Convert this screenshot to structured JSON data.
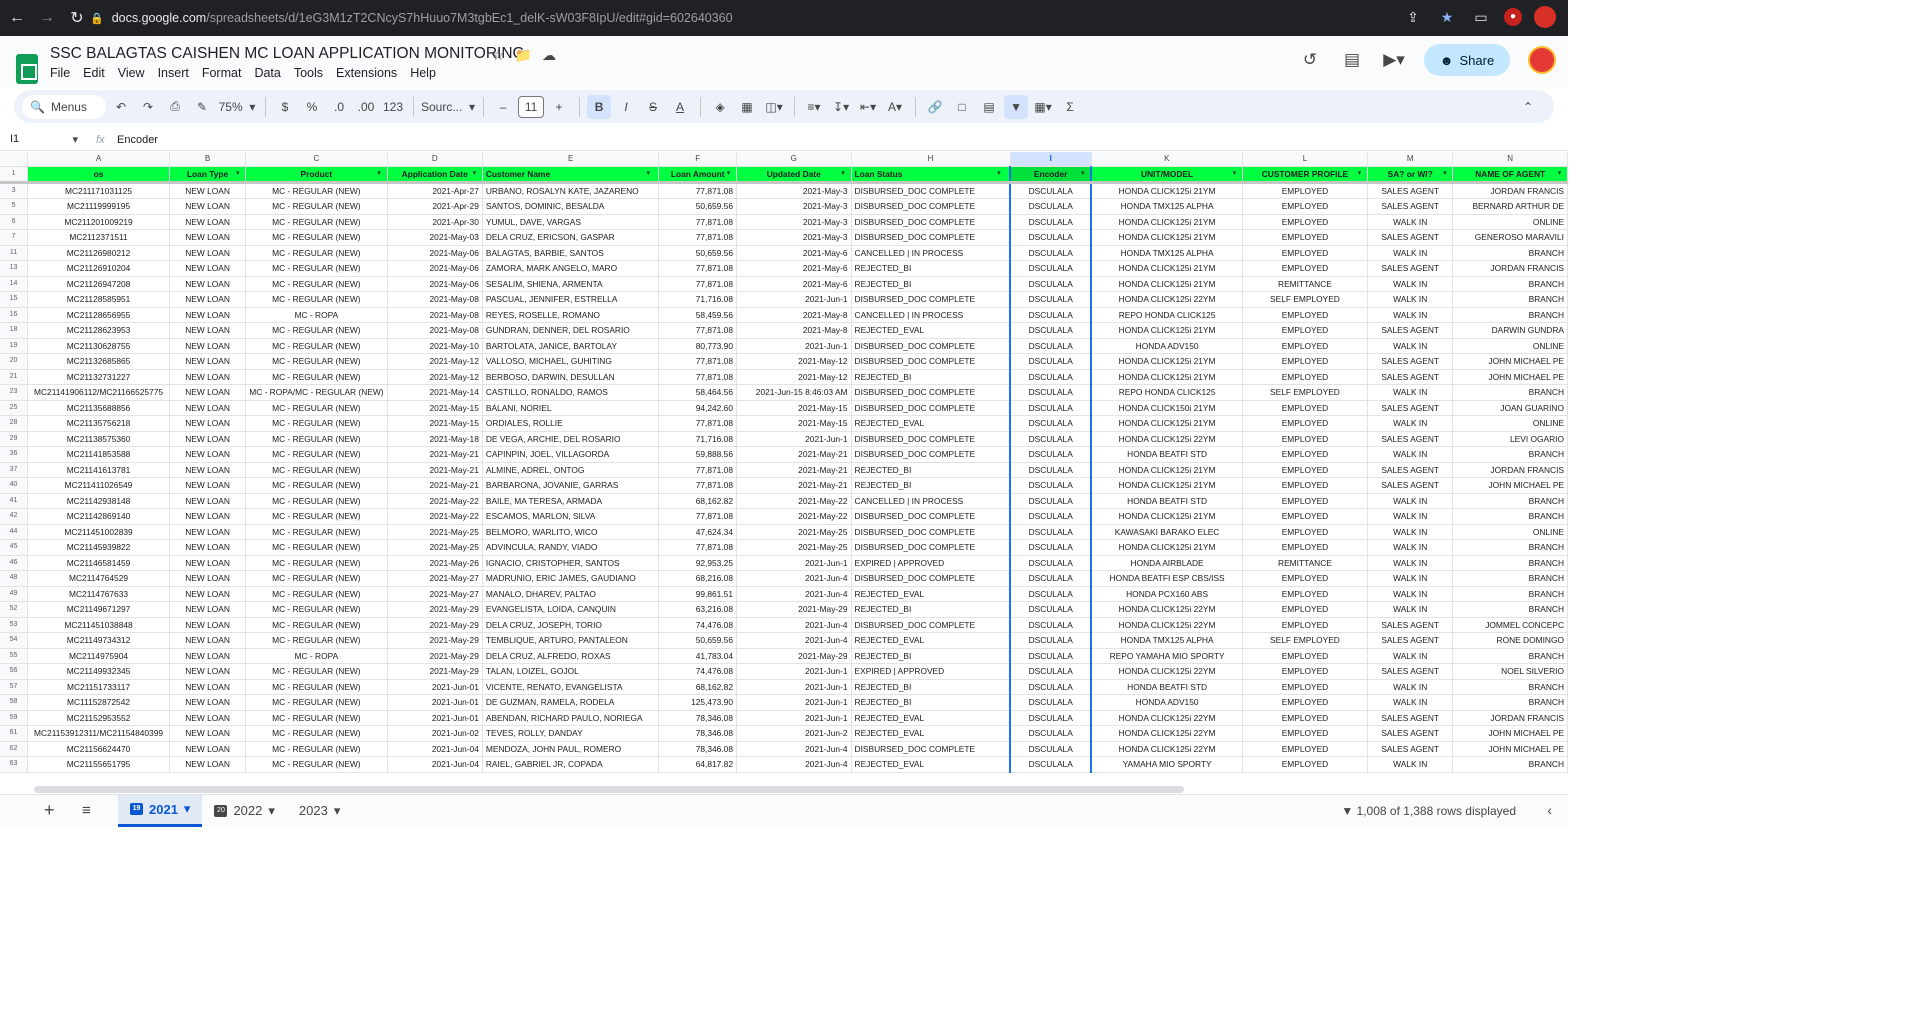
{
  "browser": {
    "url_domain": "docs.google.com",
    "url_path": "/spreadsheets/d/1eG3M1zT2CNcyS7hHuuo7M3tgbEc1_delK-sW03F8IpU/edit#gid=602640360"
  },
  "doc": {
    "title": "SSC BALAGTAS CAISHEN MC LOAN APPLICATION MONITORING",
    "menus": [
      "File",
      "Edit",
      "View",
      "Insert",
      "Format",
      "Data",
      "Tools",
      "Extensions",
      "Help"
    ],
    "share_label": "Share"
  },
  "toolbar": {
    "search_label": "Menus",
    "zoom": "75%",
    "currency": "$",
    "percent": "%",
    "dec_less": ".0",
    "dec_more": ".00",
    "number_format": "123",
    "font": "Sourc...",
    "font_size": "11"
  },
  "formula": {
    "cell": "I1",
    "content": "Encoder"
  },
  "columns": [
    "A",
    "B",
    "C",
    "D",
    "E",
    "F",
    "G",
    "H",
    "I",
    "K",
    "L",
    "M",
    "N"
  ],
  "headers": [
    "os",
    "Loan Type",
    "Product",
    "Application Date",
    "Customer Name",
    "Loan Amount",
    "Updated Date",
    "Loan Status",
    "Encoder",
    "UNIT/MODEL",
    "CUSTOMER PROFILE",
    "SA? or WI?",
    "NAME OF AGENT"
  ],
  "rows": [
    [
      "3",
      "MC211171031125",
      "NEW LOAN",
      "MC - REGULAR (NEW)",
      "2021-Apr-27",
      "URBANO, ROSALYN KATE, JAZARENO",
      "77,871.08",
      "2021-May-3",
      "DISBURSED_DOC COMPLETE",
      "DSCULALA",
      "HONDA CLICK125i 21YM",
      "EMPLOYED",
      "SALES AGENT",
      "JORDAN FRANCIS"
    ],
    [
      "5",
      "MC21119999195",
      "NEW LOAN",
      "MC - REGULAR (NEW)",
      "2021-Apr-29",
      "SANTOS, DOMINIC, BESALDA",
      "50,659.56",
      "2021-May-3",
      "DISBURSED_DOC COMPLETE",
      "DSCULALA",
      "HONDA TMX125 ALPHA",
      "EMPLOYED",
      "SALES AGENT",
      "BERNARD ARTHUR DE"
    ],
    [
      "6",
      "MC211201009219",
      "NEW LOAN",
      "MC - REGULAR (NEW)",
      "2021-Apr-30",
      "YUMUL, DAVE, VARGAS",
      "77,871.08",
      "2021-May-3",
      "DISBURSED_DOC COMPLETE",
      "DSCULALA",
      "HONDA CLICK125i 21YM",
      "EMPLOYED",
      "WALK IN",
      "ONLINE"
    ],
    [
      "7",
      "MC2112371511",
      "NEW LOAN",
      "MC - REGULAR (NEW)",
      "2021-May-03",
      "DELA CRUZ, ERICSON, GASPAR",
      "77,871.08",
      "2021-May-3",
      "DISBURSED_DOC COMPLETE",
      "DSCULALA",
      "HONDA CLICK125i 21YM",
      "EMPLOYED",
      "SALES AGENT",
      "GENEROSO MARAVILI"
    ],
    [
      "11",
      "MC21126980212",
      "NEW LOAN",
      "MC - REGULAR (NEW)",
      "2021-May-06",
      "BALAGTAS, BARBIE, SANTOS",
      "50,659.56",
      "2021-May-6",
      "CANCELLED | IN PROCESS",
      "DSCULALA",
      "HONDA TMX125 ALPHA",
      "EMPLOYED",
      "WALK IN",
      "BRANCH"
    ],
    [
      "13",
      "MC21126910204",
      "NEW LOAN",
      "MC - REGULAR (NEW)",
      "2021-May-06",
      "ZAMORA, MARK ANGELO, MARO",
      "77,871.08",
      "2021-May-6",
      "REJECTED_BI",
      "DSCULALA",
      "HONDA CLICK125i 21YM",
      "EMPLOYED",
      "SALES AGENT",
      "JORDAN FRANCIS"
    ],
    [
      "14",
      "MC21126947208",
      "NEW LOAN",
      "MC - REGULAR (NEW)",
      "2021-May-06",
      "SESALIM, SHIENA, ARMENTA",
      "77,871.08",
      "2021-May-6",
      "REJECTED_BI",
      "DSCULALA",
      "HONDA CLICK125i 21YM",
      "REMITTANCE",
      "WALK IN",
      "BRANCH"
    ],
    [
      "15",
      "MC21128585951",
      "NEW LOAN",
      "MC - REGULAR (NEW)",
      "2021-May-08",
      "PASCUAL, JENNIFER, ESTRELLA",
      "71,716.08",
      "2021-Jun-1",
      "DISBURSED_DOC COMPLETE",
      "DSCULALA",
      "HONDA CLICK125i 22YM",
      "SELF EMPLOYED",
      "WALK IN",
      "BRANCH"
    ],
    [
      "16",
      "MC21128656955",
      "NEW LOAN",
      "MC - ROPA",
      "2021-May-08",
      "REYES, ROSELLE, ROMANO",
      "58,459.56",
      "2021-May-8",
      "CANCELLED | IN PROCESS",
      "DSCULALA",
      "REPO HONDA CLICK125",
      "EMPLOYED",
      "WALK IN",
      "BRANCH"
    ],
    [
      "18",
      "MC21128623953",
      "NEW LOAN",
      "MC - REGULAR (NEW)",
      "2021-May-08",
      "GUNDRAN, DENNER, DEL ROSARIO",
      "77,871.08",
      "2021-May-8",
      "REJECTED_EVAL",
      "DSCULALA",
      "HONDA CLICK125i 21YM",
      "EMPLOYED",
      "SALES AGENT",
      "DARWIN GUNDRA"
    ],
    [
      "19",
      "MC21130628755",
      "NEW LOAN",
      "MC - REGULAR (NEW)",
      "2021-May-10",
      "BARTOLATA, JANICE, BARTOLAY",
      "80,773.90",
      "2021-Jun-1",
      "DISBURSED_DOC COMPLETE",
      "DSCULALA",
      "HONDA ADV150",
      "EMPLOYED",
      "WALK IN",
      "ONLINE"
    ],
    [
      "20",
      "MC21132685865",
      "NEW LOAN",
      "MC - REGULAR (NEW)",
      "2021-May-12",
      "VALLOSO, MICHAEL, GUHITING",
      "77,871.08",
      "2021-May-12",
      "DISBURSED_DOC COMPLETE",
      "DSCULALA",
      "HONDA CLICK125i 21YM",
      "EMPLOYED",
      "SALES AGENT",
      "JOHN MICHAEL PE"
    ],
    [
      "21",
      "MC21132731227",
      "NEW LOAN",
      "MC - REGULAR (NEW)",
      "2021-May-12",
      "BERBOSO, DARWIN, DESULLAN",
      "77,871.08",
      "2021-May-12",
      "REJECTED_BI",
      "DSCULALA",
      "HONDA CLICK125i 21YM",
      "EMPLOYED",
      "SALES AGENT",
      "JOHN MICHAEL PE"
    ],
    [
      "23",
      "MC21141906112/MC21166525775",
      "NEW LOAN",
      "MC - ROPA/MC - REGULAR (NEW)",
      "2021-May-14",
      "CASTILLO, RONALDO, RAMOS",
      "58,464.56",
      "2021-Jun-15 8:46:03 AM",
      "DISBURSED_DOC COMPLETE",
      "DSCULALA",
      "REPO HONDA CLICK125",
      "SELF EMPLOYED",
      "WALK IN",
      "BRANCH"
    ],
    [
      "25",
      "MC21135688856",
      "NEW LOAN",
      "MC - REGULAR (NEW)",
      "2021-May-15",
      "BALANI, NORIEL",
      "94,242.60",
      "2021-May-15",
      "DISBURSED_DOC COMPLETE",
      "DSCULALA",
      "HONDA CLICK150i 21YM",
      "EMPLOYED",
      "SALES AGENT",
      "JOAN GUARINO"
    ],
    [
      "28",
      "MC21135756218",
      "NEW LOAN",
      "MC - REGULAR (NEW)",
      "2021-May-15",
      "ORDIALES, ROLLIE",
      "77,871.08",
      "2021-May-15",
      "REJECTED_EVAL",
      "DSCULALA",
      "HONDA CLICK125i 21YM",
      "EMPLOYED",
      "WALK IN",
      "ONLINE"
    ],
    [
      "29",
      "MC21138575360",
      "NEW LOAN",
      "MC - REGULAR (NEW)",
      "2021-May-18",
      "DE VEGA, ARCHIE, DEL ROSARIO",
      "71,716.08",
      "2021-Jun-1",
      "DISBURSED_DOC COMPLETE",
      "DSCULALA",
      "HONDA CLICK125i 22YM",
      "EMPLOYED",
      "SALES AGENT",
      "LEVI OGARIO"
    ],
    [
      "36",
      "MC21141853588",
      "NEW LOAN",
      "MC - REGULAR (NEW)",
      "2021-May-21",
      "CAPINPIN, JOEL, VILLAGORDA",
      "59,888.56",
      "2021-May-21",
      "DISBURSED_DOC COMPLETE",
      "DSCULALA",
      "HONDA BEATFI STD",
      "EMPLOYED",
      "WALK IN",
      "BRANCH"
    ],
    [
      "37",
      "MC21141613781",
      "NEW LOAN",
      "MC - REGULAR (NEW)",
      "2021-May-21",
      "ALMINE, ADREL, ONTOG",
      "77,871.08",
      "2021-May-21",
      "REJECTED_BI",
      "DSCULALA",
      "HONDA CLICK125i 21YM",
      "EMPLOYED",
      "SALES AGENT",
      "JORDAN FRANCIS"
    ],
    [
      "40",
      "MC211411026549",
      "NEW LOAN",
      "MC - REGULAR (NEW)",
      "2021-May-21",
      "BARBARONA, JOVANIE, GARRAS",
      "77,871.08",
      "2021-May-21",
      "REJECTED_BI",
      "DSCULALA",
      "HONDA CLICK125i 21YM",
      "EMPLOYED",
      "SALES AGENT",
      "JOHN MICHAEL PE"
    ],
    [
      "41",
      "MC21142938148",
      "NEW LOAN",
      "MC - REGULAR (NEW)",
      "2021-May-22",
      "BAILE, MA TERESA, ARMADA",
      "68,162.82",
      "2021-May-22",
      "CANCELLED | IN PROCESS",
      "DSCULALA",
      "HONDA BEATFI STD",
      "EMPLOYED",
      "WALK IN",
      "BRANCH"
    ],
    [
      "42",
      "MC21142869140",
      "NEW LOAN",
      "MC - REGULAR (NEW)",
      "2021-May-22",
      "ESCAMOS, MARLON, SILVA",
      "77,871.08",
      "2021-May-22",
      "DISBURSED_DOC COMPLETE",
      "DSCULALA",
      "HONDA CLICK125i 21YM",
      "EMPLOYED",
      "WALK IN",
      "BRANCH"
    ],
    [
      "44",
      "MC211451002839",
      "NEW LOAN",
      "MC - REGULAR (NEW)",
      "2021-May-25",
      "BELMORO, WARLITO, WICO",
      "47,624.34",
      "2021-May-25",
      "DISBURSED_DOC COMPLETE",
      "DSCULALA",
      "KAWASAKI BARAKO ELEC",
      "EMPLOYED",
      "WALK IN",
      "ONLINE"
    ],
    [
      "45",
      "MC21145939822",
      "NEW LOAN",
      "MC - REGULAR (NEW)",
      "2021-May-25",
      "ADVINCULA, RANDY, VIADO",
      "77,871.08",
      "2021-May-25",
      "DISBURSED_DOC COMPLETE",
      "DSCULALA",
      "HONDA CLICK125i 21YM",
      "EMPLOYED",
      "WALK IN",
      "BRANCH"
    ],
    [
      "46",
      "MC21146581459",
      "NEW LOAN",
      "MC - REGULAR (NEW)",
      "2021-May-26",
      "IGNACIO, CRISTOPHER, SANTOS",
      "92,953.25",
      "2021-Jun-1",
      "EXPIRED | APPROVED",
      "DSCULALA",
      "HONDA AIRBLADE",
      "REMITTANCE",
      "WALK IN",
      "BRANCH"
    ],
    [
      "48",
      "MC2114764529",
      "NEW LOAN",
      "MC - REGULAR (NEW)",
      "2021-May-27",
      "MADRUNIO, ERIC JAMES, GAUDIANO",
      "68,216.08",
      "2021-Jun-4",
      "DISBURSED_DOC COMPLETE",
      "DSCULALA",
      "HONDA BEATFI ESP CBS/ISS",
      "EMPLOYED",
      "WALK IN",
      "BRANCH"
    ],
    [
      "49",
      "MC2114767633",
      "NEW LOAN",
      "MC - REGULAR (NEW)",
      "2021-May-27",
      "MANALO, DHAREV, PALTAO",
      "99,861.51",
      "2021-Jun-4",
      "REJECTED_EVAL",
      "DSCULALA",
      "HONDA PCX160 ABS",
      "EMPLOYED",
      "WALK IN",
      "BRANCH"
    ],
    [
      "52",
      "MC21149671297",
      "NEW LOAN",
      "MC - REGULAR (NEW)",
      "2021-May-29",
      "EVANGELISTA, LOIDA, CANQUIN",
      "63,216.08",
      "2021-May-29",
      "REJECTED_BI",
      "DSCULALA",
      "HONDA CLICK125i 22YM",
      "EMPLOYED",
      "WALK IN",
      "BRANCH"
    ],
    [
      "53",
      "MC211451038848",
      "NEW LOAN",
      "MC - REGULAR (NEW)",
      "2021-May-29",
      "DELA CRUZ, JOSEPH, TORIO",
      "74,476.08",
      "2021-Jun-4",
      "DISBURSED_DOC COMPLETE",
      "DSCULALA",
      "HONDA CLICK125i 22YM",
      "EMPLOYED",
      "SALES AGENT",
      "JOMMEL CONCEPC"
    ],
    [
      "54",
      "MC21149734312",
      "NEW LOAN",
      "MC - REGULAR (NEW)",
      "2021-May-29",
      "TEMBLIQUE, ARTURO, PANTALEON",
      "50,659.56",
      "2021-Jun-4",
      "REJECTED_EVAL",
      "DSCULALA",
      "HONDA TMX125 ALPHA",
      "SELF EMPLOYED",
      "SALES AGENT",
      "RONE DOMINGO"
    ],
    [
      "55",
      "MC2114975904",
      "NEW LOAN",
      "MC - ROPA",
      "2021-May-29",
      "DELA CRUZ, ALFREDO, ROXAS",
      "41,783.04",
      "2021-May-29",
      "REJECTED_BI",
      "DSCULALA",
      "REPO YAMAHA MIO SPORTY",
      "EMPLOYED",
      "WALK IN",
      "BRANCH"
    ],
    [
      "56",
      "MC21149932345",
      "NEW LOAN",
      "MC - REGULAR (NEW)",
      "2021-May-29",
      "TALAN, LOIZEL, GOJOL",
      "74,476.08",
      "2021-Jun-1",
      "EXPIRED | APPROVED",
      "DSCULALA",
      "HONDA CLICK125i 22YM",
      "EMPLOYED",
      "SALES AGENT",
      "NOEL SILVERIO"
    ],
    [
      "57",
      "MC21151733117",
      "NEW LOAN",
      "MC - REGULAR (NEW)",
      "2021-Jun-01",
      "VICENTE, RENATO, EVANGELISTA",
      "68,162.82",
      "2021-Jun-1",
      "REJECTED_BI",
      "DSCULALA",
      "HONDA BEATFI STD",
      "EMPLOYED",
      "WALK IN",
      "BRANCH"
    ],
    [
      "58",
      "MC11152872542",
      "NEW LOAN",
      "MC - REGULAR (NEW)",
      "2021-Jun-01",
      "DE GUZMAN, RAMELA, RODELA",
      "125,473.90",
      "2021-Jun-1",
      "REJECTED_BI",
      "DSCULALA",
      "HONDA ADV150",
      "EMPLOYED",
      "WALK IN",
      "BRANCH"
    ],
    [
      "59",
      "MC21152953552",
      "NEW LOAN",
      "MC - REGULAR (NEW)",
      "2021-Jun-01",
      "ABENDAN, RICHARD PAULO, NORIEGA",
      "78,346.08",
      "2021-Jun-1",
      "REJECTED_EVAL",
      "DSCULALA",
      "HONDA CLICK125i 22YM",
      "EMPLOYED",
      "SALES AGENT",
      "JORDAN FRANCIS"
    ],
    [
      "61",
      "MC21153912311/MC21154840399",
      "NEW LOAN",
      "MC - REGULAR (NEW)",
      "2021-Jun-02",
      "TEVES, ROLLY, DANDAY",
      "78,346.08",
      "2021-Jun-2",
      "REJECTED_EVAL",
      "DSCULALA",
      "HONDA CLICK125i 22YM",
      "EMPLOYED",
      "SALES AGENT",
      "JOHN MICHAEL PE"
    ],
    [
      "62",
      "MC21156624470",
      "NEW LOAN",
      "MC - REGULAR (NEW)",
      "2021-Jun-04",
      "MENDOZA, JOHN PAUL, ROMERO",
      "78,346.08",
      "2021-Jun-4",
      "DISBURSED_DOC COMPLETE",
      "DSCULALA",
      "HONDA CLICK125i 22YM",
      "EMPLOYED",
      "SALES AGENT",
      "JOHN MICHAEL PE"
    ],
    [
      "63",
      "MC21155651795",
      "NEW LOAN",
      "MC - REGULAR (NEW)",
      "2021-Jun-04",
      "RAIEL, GABRIEL JR, COPADA",
      "64,817.82",
      "2021-Jun-4",
      "REJECTED_EVAL",
      "DSCULALA",
      "YAMAHA MIO SPORTY",
      "EMPLOYED",
      "WALK IN",
      "BRANCH"
    ]
  ],
  "sheet_tabs": {
    "tabs": [
      {
        "badge": "19",
        "label": "2021",
        "active": true
      },
      {
        "badge": "20",
        "label": "2022",
        "active": false
      },
      {
        "badge": "",
        "label": "2023",
        "active": false
      }
    ],
    "rows_status": "1,008 of 1,388 rows displayed"
  }
}
